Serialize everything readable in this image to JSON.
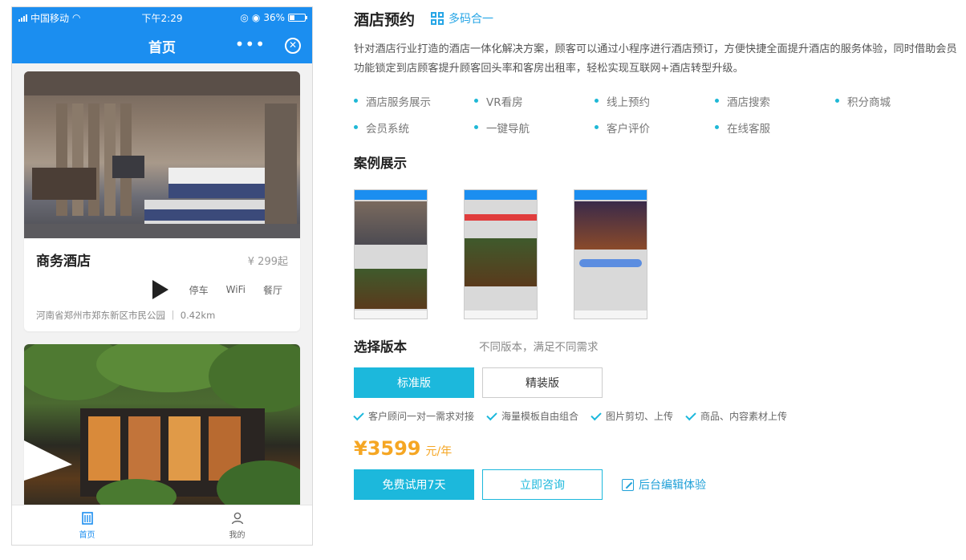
{
  "phone": {
    "status": {
      "carrier": "中国移动",
      "time": "下午2:29",
      "battery": "36%",
      "battery_level": 0.36
    },
    "nav": {
      "title": "首页",
      "more": "•••",
      "close": "✕"
    },
    "cards": [
      {
        "title": "商务酒店",
        "price": "¥ 299起",
        "tags": [
          "停车",
          "WiFi",
          "餐厅"
        ],
        "address": "河南省郑州市郑东新区市民公园 ｜ 0.42km"
      },
      {
        "title": "",
        "price": "",
        "tags": [],
        "address": ""
      }
    ],
    "tabs": [
      {
        "label": "首页",
        "icon": "building-icon",
        "active": true
      },
      {
        "label": "我的",
        "icon": "user-icon",
        "active": false
      }
    ]
  },
  "panel": {
    "title": "酒店预约",
    "badge": "多码合一",
    "description": "针对酒店行业打造的酒店一体化解决方案，顾客可以通过小程序进行酒店预订，方便快捷全面提升酒店的服务体验，同时借助会员功能锁定到店顾客提升顾客回头率和客房出租率，轻松实现互联网+酒店转型升级。",
    "features": [
      "酒店服务展示",
      "VR看房",
      "线上预约",
      "酒店搜索",
      "积分商城",
      "会员系统",
      "一键导航",
      "客户评价",
      "在线客服"
    ],
    "cases_title": "案例展示",
    "version_title": "选择版本",
    "version_hint": "不同版本，满足不同需求",
    "versions": [
      {
        "label": "标准版",
        "selected": true
      },
      {
        "label": "精装版",
        "selected": false
      }
    ],
    "checks": [
      "客户顾问一对一需求对接",
      "海量模板自由组合",
      "图片剪切、上传",
      "商品、内容素材上传"
    ],
    "price": "¥3599",
    "price_unit": "元/年",
    "trial_button": "免费试用7天",
    "consult_button": "立即咨询",
    "edit_link": "后台编辑体验",
    "accent_color": "#1cb8dc",
    "price_color": "#f5a623"
  }
}
